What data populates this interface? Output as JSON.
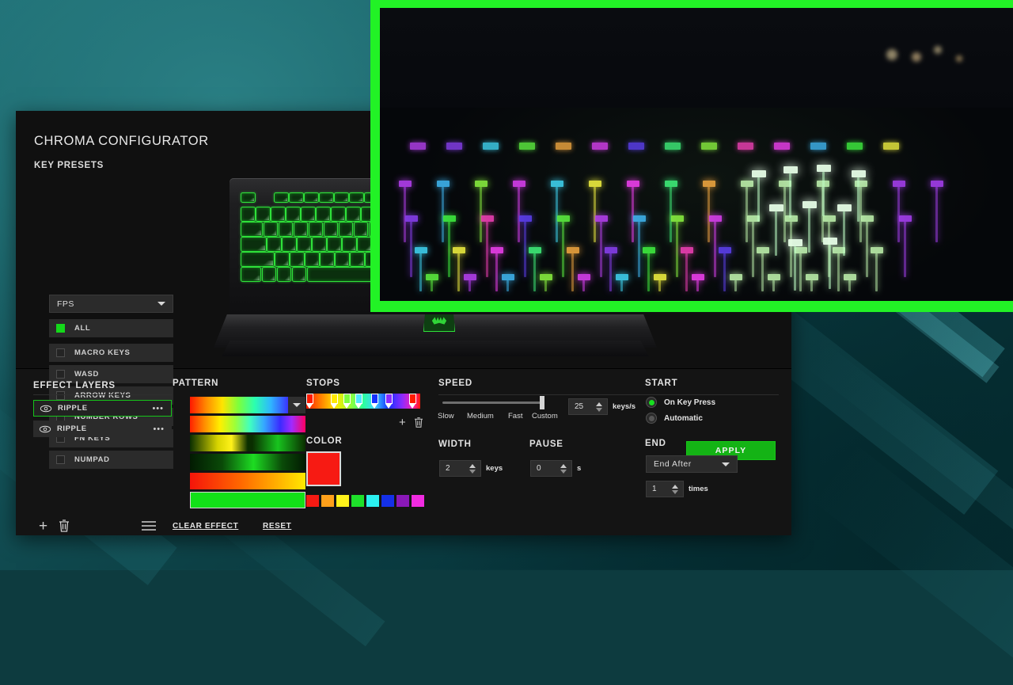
{
  "app": {
    "title": "CHROMA CONFIGURATOR",
    "key_presets_label": "KEY PRESETS",
    "preset_selected": "FPS",
    "apply_label": "APPLY",
    "accent_green": "#14b315",
    "panel_bg": "#101010"
  },
  "key_presets": [
    {
      "label": "ALL",
      "checked": true
    },
    {
      "label": "MACRO KEYS",
      "checked": false
    },
    {
      "label": "WASD",
      "checked": false
    },
    {
      "label": "ARROW KEYS",
      "checked": false
    },
    {
      "label": "NUMBER ROWS",
      "checked": false
    },
    {
      "label": "FN KEYS",
      "checked": false
    },
    {
      "label": "NUMPAD",
      "checked": false
    }
  ],
  "effect_layers": {
    "title": "EFFECT LAYERS",
    "items": [
      {
        "label": "RIPPLE",
        "visible": true,
        "selected": true
      },
      {
        "label": "RIPPLE",
        "visible": true,
        "selected": false
      }
    ],
    "add_icon": "plus-icon",
    "delete_icon": "trash-icon",
    "menu_icon": "hamburger-icon"
  },
  "pattern": {
    "title": "PATTERN",
    "clear_effect_label": "CLEAR EFFECT",
    "reset_label": "RESET",
    "selected_index": 5,
    "swatches": [
      {
        "name": "spectrum-wide",
        "css": "linear-gradient(90deg,#ff1800 0%,#ff8a00 14%,#ffe400 28%,#7dff3c 42%,#2bffb0 56%,#2fb6ff 70%,#3a2bff 86%,#6a00ff 100%)"
      },
      {
        "name": "spectrum-magenta",
        "css": "linear-gradient(90deg,#ff2200 0%,#ff9000 13%,#fff000 26%,#9dff38 39%,#40ffc0 52%,#35a8ff 64%,#3a2bff 78%,#a02bff 88%,#ff0060 100%)"
      },
      {
        "name": "yellow-green-split",
        "css": "linear-gradient(90deg,#0a2e00 0%,#d8d400 24%,#fff21a 36%,#0a2e00 50%,#0a2e00 54%,#18c41e 76%,#0a2e00 100%)"
      },
      {
        "name": "green-fade",
        "css": "linear-gradient(90deg,#021a02 0%,#0a4a08 28%,#1ddc22 55%,#0a4a08 80%,#021a02 100%)"
      },
      {
        "name": "red-orange-yellow",
        "css": "linear-gradient(90deg,#f5140a 0%,#ff6a00 45%,#ffe800 100%)"
      },
      {
        "name": "solid-green",
        "css": "linear-gradient(90deg,#12e018 0%,#12e018 100%)"
      }
    ]
  },
  "stops": {
    "title": "STOPS",
    "add_icon": "plus-icon",
    "delete_icon": "trash-icon",
    "markers": [
      {
        "position_pct": 0,
        "color": "#ff1a00"
      },
      {
        "position_pct": 23,
        "color": "#ffe800"
      },
      {
        "position_pct": 35,
        "color": "#7dff3c"
      },
      {
        "position_pct": 46,
        "color": "#4fe6ff"
      },
      {
        "position_pct": 61,
        "color": "#1430ff"
      },
      {
        "position_pct": 74,
        "color": "#8a2bff"
      },
      {
        "position_pct": 96,
        "color": "#ff1a00"
      }
    ]
  },
  "color": {
    "title": "COLOR",
    "current": "#f71a13",
    "palette": [
      "#f71a13",
      "#ffa01a",
      "#fff21a",
      "#1ee02a",
      "#2bf0f0",
      "#1430e8",
      "#8a18b8",
      "#f02be0"
    ]
  },
  "speed": {
    "title": "SPEED",
    "ticks": [
      "Slow",
      "Medium",
      "Fast",
      "Custom"
    ],
    "selected_tick": "Custom",
    "value": "25",
    "unit": "keys/s",
    "slider_pct": 96
  },
  "width": {
    "title": "WIDTH",
    "value": "2",
    "unit": "keys"
  },
  "pause": {
    "title": "PAUSE",
    "value": "0",
    "unit": "s"
  },
  "start": {
    "title": "START",
    "options": [
      {
        "label": "On Key Press",
        "selected": true
      },
      {
        "label": "Automatic",
        "selected": false
      }
    ]
  },
  "end": {
    "title": "END",
    "mode": "End After",
    "value": "1",
    "unit": "times"
  },
  "video_overlay": {
    "name": "keyboard-photo-overlay",
    "border_color": "#22f226",
    "caption": ""
  }
}
